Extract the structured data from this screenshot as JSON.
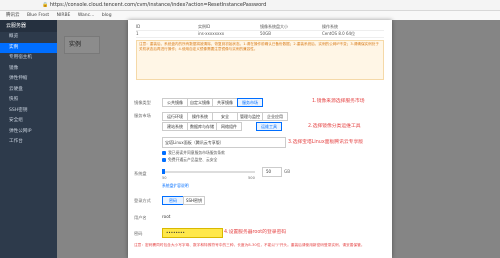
{
  "browser": {
    "url": "https://console.cloud.tencent.com/cvm/instance/index?action=ResetInstancePassword"
  },
  "bookmarks": [
    "腾讯云",
    "Blue Frost",
    "NIRBE",
    "Wanc...",
    "blog"
  ],
  "sidebar": {
    "logo": "腾讯云",
    "title": "云服务器",
    "items": [
      "概览",
      "实例",
      "专用宿主机",
      "镜像",
      "弹性伸缩",
      "云硬盘",
      "快照",
      "SSH密钥",
      "安全组",
      "弹性公网IP",
      "工作台"
    ]
  },
  "background": {
    "tab": "实例"
  },
  "modal": {
    "table": {
      "headers": [
        "ID",
        "实例ID",
        "镜像系统盘大小",
        "操作系统"
      ],
      "row": [
        "1",
        "ins-xxxxxxxx",
        "50GB",
        "CentOS 8.0 64位"
      ]
    },
    "warning": "注意：重装后，系统盘内的所有数据将被清除，恢复到初始状态。1.请在操作前确认已备份数据；2.重装系统后，实例的公网IP不变；3.请确保实例处于关机状态后再进行操作；4.使用自定义镜像需要注意镜像与实例的兼容性。",
    "image_type": {
      "label": "镜像类型",
      "options": [
        "公共镜像",
        "自定义镜像",
        "共享镜像",
        "服务市场"
      ],
      "selected_index": 3,
      "annotation": "1.镜像来源选择服务市场"
    },
    "market_category": {
      "label": "服务市场",
      "options": [
        "运行环境",
        "操作系统",
        "安全",
        "管理与监控",
        "企业应用",
        "建站系统",
        "数据库与存储",
        "网络组件",
        "运维工具"
      ],
      "selected_index": 8,
      "annotation": "2.选择镜像分类运维工具"
    },
    "image_select": {
      "value": "宝塔Linux面板（腾讯云专享版）",
      "annotation": "3.选择宝塔Linux面板腾讯云专享版"
    },
    "agreements": [
      "我已阅读并同意服务市场服务条款",
      "免费开通云产品监控、云安全"
    ],
    "system_disk": {
      "label": "系统盘",
      "min": "50",
      "max": "500",
      "value": "50",
      "unit": "GB",
      "note": "系统盘扩容说明"
    },
    "login": {
      "label": "登录方式",
      "options": [
        "密码",
        "SSH密钥"
      ],
      "selected_index": 0
    },
    "username": {
      "label": "用户名",
      "value": "root"
    },
    "password": {
      "label": "密码",
      "value": "••••••••",
      "annotation": "4.设置服务器root的登录密码"
    },
    "footnote": "注意：密码需同时包含大小写字母、数字和特殊符号中的三种，长度为8-30位，不能以\"/\"开头。重装后请使用新密码登录实例，请妥善保管。"
  }
}
